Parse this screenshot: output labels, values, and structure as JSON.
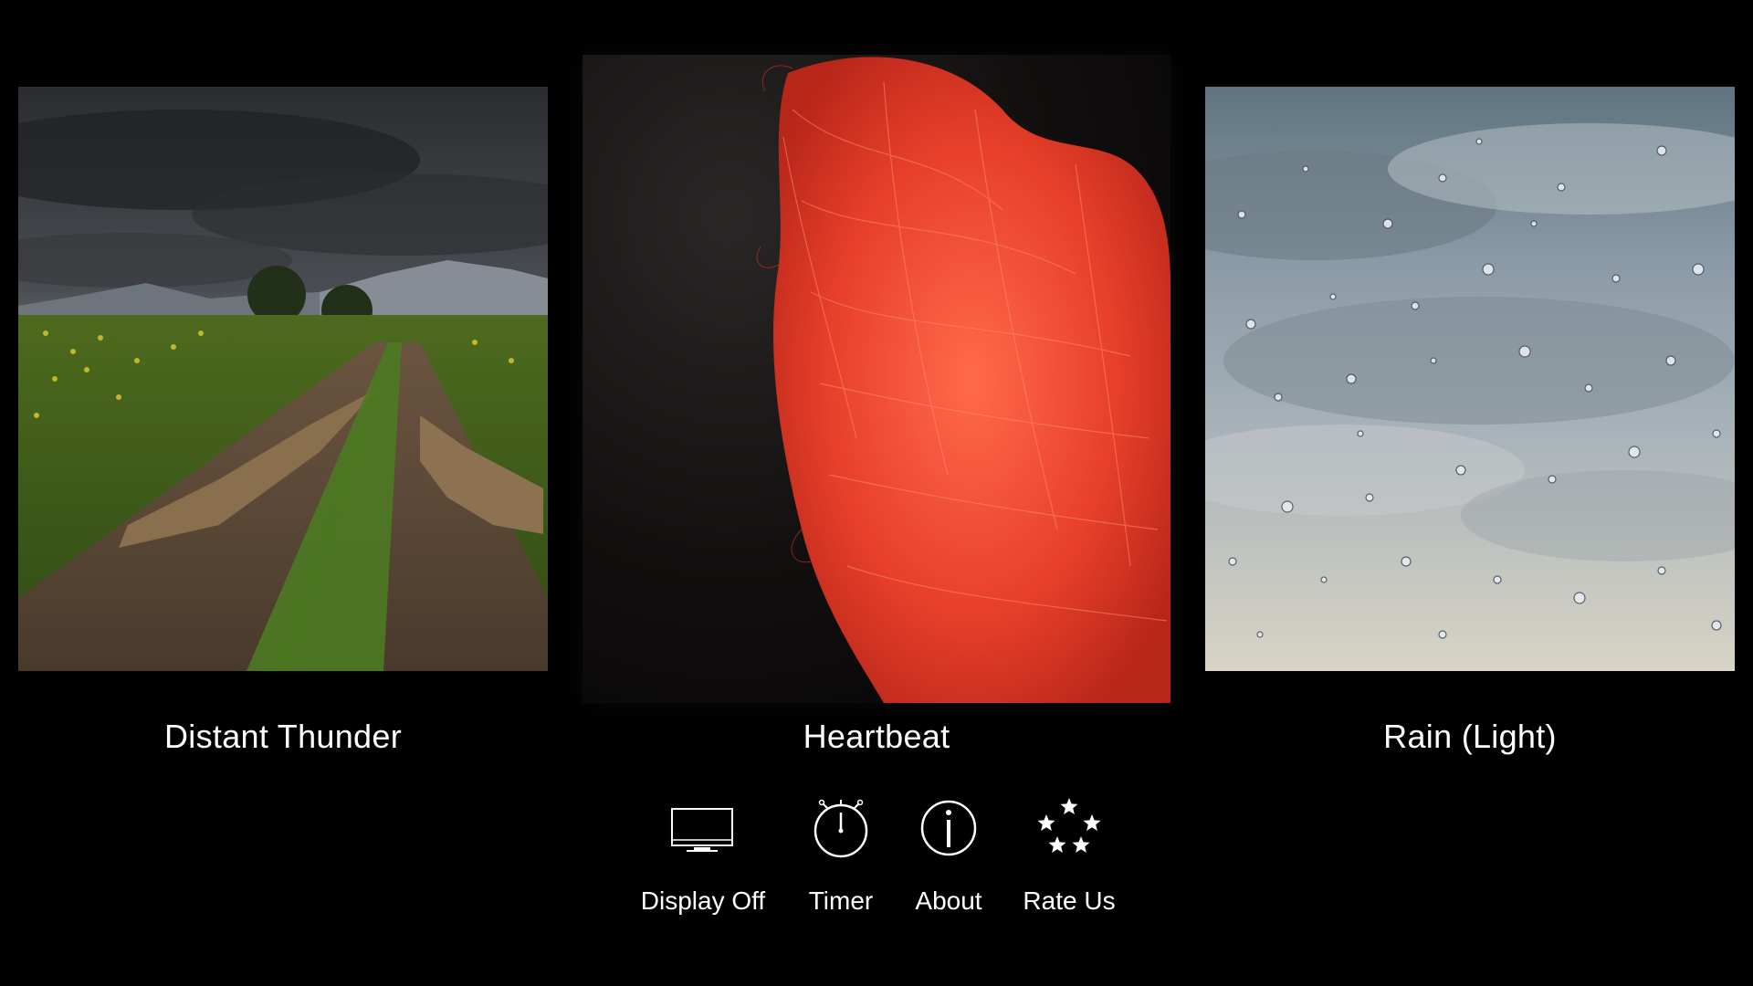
{
  "sounds": [
    {
      "title": "Distant Thunder",
      "image": "stormy-field-path-photo"
    },
    {
      "title": "Heartbeat",
      "image": "red-fiber-heart-photo"
    },
    {
      "title": "Rain (Light)",
      "image": "raindrops-on-window-photo"
    }
  ],
  "controls": [
    {
      "label": "Display Off",
      "icon": "display-off-icon"
    },
    {
      "label": "Timer",
      "icon": "stopwatch-icon"
    },
    {
      "label": "About",
      "icon": "info-icon"
    },
    {
      "label": "Rate Us",
      "icon": "stars-icon"
    }
  ],
  "colors": {
    "background": "#000000",
    "text": "#ffffff",
    "heartbeat_red": "#e8402a",
    "storm_gray": "#3a3d42",
    "rain_sky": "#8a9aa6"
  }
}
